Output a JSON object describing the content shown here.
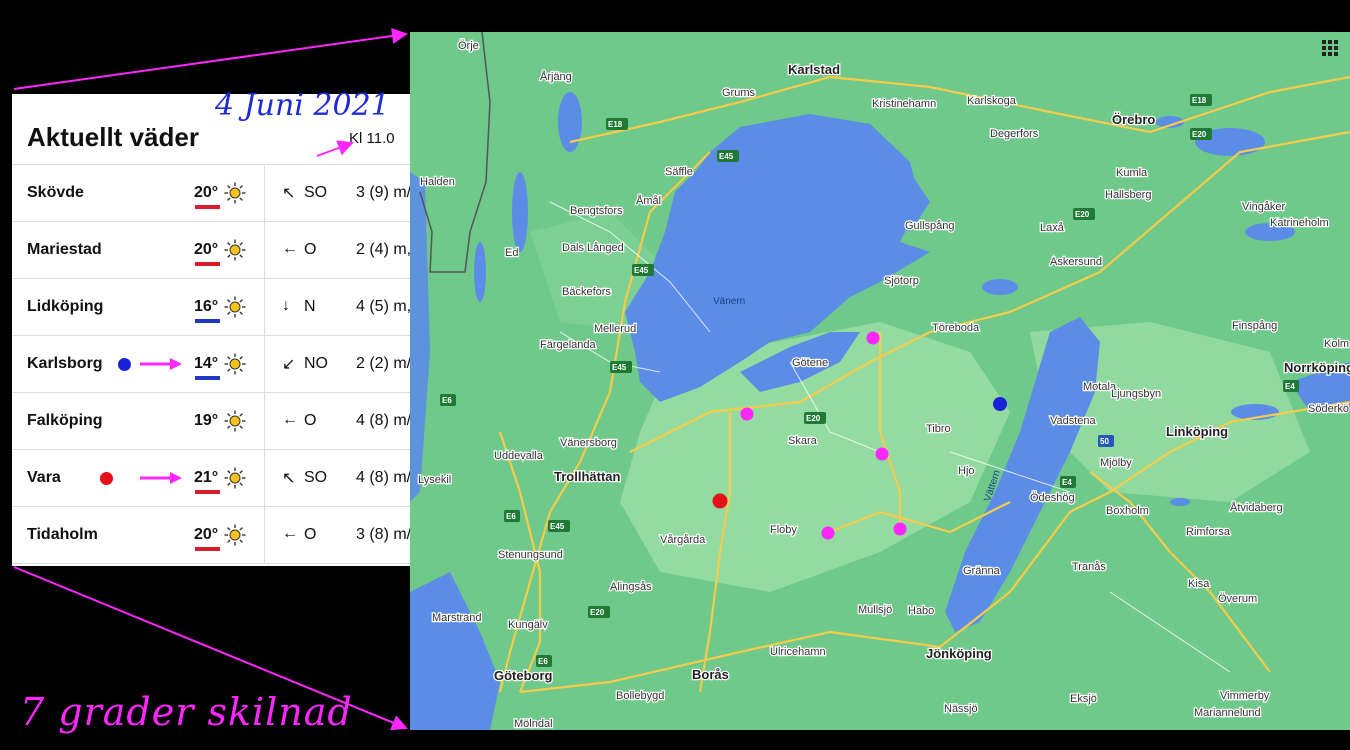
{
  "weather": {
    "title": "Aktuellt väder",
    "time": "Kl 11.0",
    "rows": [
      {
        "city": "Skövde",
        "temp": "20°",
        "dir_arrow": "↖",
        "dir": "SO",
        "wind": "3 (9) m/",
        "underline": "#d81e2a",
        "dot": null,
        "arrow": false
      },
      {
        "city": "Mariestad",
        "temp": "20°",
        "dir_arrow": "←",
        "dir": "O",
        "wind": "2 (4) m,",
        "underline": "#d81e2a",
        "dot": null,
        "arrow": false
      },
      {
        "city": "Lidköping",
        "temp": "16°",
        "dir_arrow": "↓",
        "dir": "N",
        "wind": "4 (5) m,",
        "underline": "#2337c4",
        "dot": null,
        "arrow": false
      },
      {
        "city": "Karlsborg",
        "temp": "14°",
        "dir_arrow": "↙",
        "dir": "NO",
        "wind": "2 (2) m/",
        "underline": "#2337c4",
        "dot": "#1a22d8",
        "arrow": true
      },
      {
        "city": "Falköping",
        "temp": "19°",
        "dir_arrow": "←",
        "dir": "O",
        "wind": "4 (8) m/",
        "underline": null,
        "dot": null,
        "arrow": false
      },
      {
        "city": "Vara",
        "temp": "21°",
        "dir_arrow": "↖",
        "dir": "SO",
        "wind": "4 (8) m/",
        "underline": "#d81e2a",
        "dot": "#e3101a",
        "arrow": true
      },
      {
        "city": "Tidaholm",
        "temp": "20°",
        "dir_arrow": "←",
        "dir": "O",
        "wind": "3 (8) m/",
        "underline": "#d81e2a",
        "dot": null,
        "arrow": false
      }
    ]
  },
  "annotations": {
    "date": "4 Juni 2021",
    "difference": "7 grader skilnad",
    "accent_color": "#ff27ff"
  },
  "map": {
    "lakes": {
      "vanern": "Vänern",
      "vattern": "Vättern"
    },
    "places": [
      "Karlstad",
      "Kristinehamn",
      "Karlskoga",
      "Örebro",
      "Degerfors",
      "Grums",
      "Årjäng",
      "Kumla",
      "Hallsberg",
      "Vingåker",
      "Katrineholm",
      "Säffle",
      "Åmål",
      "Bengtsfors",
      "Gullspång",
      "Laxå",
      "Askersund",
      "Dals Långed",
      "Ed",
      "Sjötorp",
      "Bäckefors",
      "Mellerud",
      "Töreboda",
      "Finspång",
      "Götene",
      "Norrköping",
      "Motala",
      "Ljungsbyn",
      "Söderkö",
      "Färgelanda",
      "Skara",
      "Vadstena",
      "Tibro",
      "Linköping",
      "Vänersborg",
      "Hjo",
      "Mjölby",
      "Uddevalla",
      "Trollhättan",
      "Ödeshög",
      "Boxholm",
      "Lysekil",
      "Floby",
      "Åtvidaberg",
      "Rimforsa",
      "Stenungsund",
      "Vårgårda",
      "Tranås",
      "Gränna",
      "Alingsås",
      "Kisa",
      "Marstrand",
      "Kungälv",
      "Mullsjö",
      "Habo",
      "Överum",
      "Ulricehamn",
      "Jönköping",
      "Göteborg",
      "Borås",
      "Bollebygd",
      "Nässjö",
      "Eksjö",
      "Vimmerby",
      "Mölndal",
      "Mariannelund",
      "Halden",
      "Örje",
      "Kolm"
    ],
    "marked_cities": [
      "Mariestad",
      "Lidköping",
      "Skövde",
      "Karlsborg",
      "Vara",
      "Falköping",
      "Tidaholm"
    ],
    "roads": [
      "E18",
      "E18",
      "E20",
      "E20",
      "E20",
      "E45",
      "E45",
      "E45",
      "E6",
      "E6",
      "E6",
      "E45",
      "E20",
      "E4",
      "E4",
      "50"
    ],
    "dot_colors": {
      "pink": "#ff27ff",
      "red": "#e3101a",
      "blue": "#1a22d8"
    }
  }
}
